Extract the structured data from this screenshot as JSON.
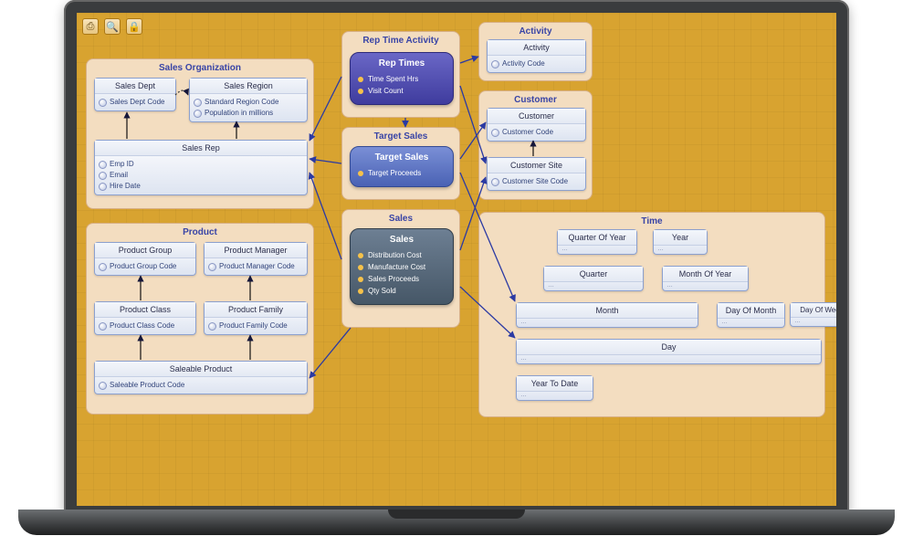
{
  "toolbar": {
    "print": "⎙",
    "zoom": "🔍",
    "lock": "🔒"
  },
  "groups": {
    "salesOrg": {
      "title": "Sales Organization"
    },
    "product": {
      "title": "Product"
    },
    "repTime": {
      "title": "Rep Time Activity"
    },
    "targetSales": {
      "title": "Target Sales"
    },
    "sales": {
      "title": "Sales"
    },
    "activity": {
      "title": "Activity"
    },
    "customer": {
      "title": "Customer"
    },
    "time": {
      "title": "Time"
    }
  },
  "entities": {
    "salesDept": {
      "hdr": "Sales Dept",
      "a1": "Sales Dept Code"
    },
    "salesRegion": {
      "hdr": "Sales Region",
      "a1": "Standard Region Code",
      "a2": "Population in millions"
    },
    "salesRep": {
      "hdr": "Sales Rep",
      "a1": "Emp ID",
      "a2": "Email",
      "a3": "Hire Date"
    },
    "productGroup": {
      "hdr": "Product Group",
      "a1": "Product Group Code"
    },
    "productManager": {
      "hdr": "Product Manager",
      "a1": "Product Manager Code"
    },
    "productClass": {
      "hdr": "Product Class",
      "a1": "Product Class Code"
    },
    "productFamily": {
      "hdr": "Product Family",
      "a1": "Product Family Code"
    },
    "saleableProduct": {
      "hdr": "Saleable Product",
      "a1": "Saleable Product Code"
    },
    "activityE": {
      "hdr": "Activity",
      "a1": "Activity Code"
    },
    "customerE": {
      "hdr": "Customer",
      "a1": "Customer Code"
    },
    "customerSite": {
      "hdr": "Customer Site",
      "a1": "Customer Site Code"
    },
    "qoy": {
      "hdr": "Quarter Of Year"
    },
    "year": {
      "hdr": "Year"
    },
    "quarter": {
      "hdr": "Quarter"
    },
    "moy": {
      "hdr": "Month Of Year"
    },
    "month": {
      "hdr": "Month"
    },
    "dom": {
      "hdr": "Day Of Month"
    },
    "dow": {
      "hdr": "Day Of Week"
    },
    "day": {
      "hdr": "Day"
    },
    "ytd": {
      "hdr": "Year To Date"
    }
  },
  "facts": {
    "repTimes": {
      "hdr": "Rep Times",
      "a1": "Time Spent Hrs",
      "a2": "Visit Count"
    },
    "targetSalesF": {
      "hdr": "Target Sales",
      "a1": "Target Proceeds"
    },
    "salesF": {
      "hdr": "Sales",
      "a1": "Distribution Cost",
      "a2": "Manufacture Cost",
      "a3": "Sales Proceeds",
      "a4": "Qty Sold"
    }
  },
  "dots": "…"
}
